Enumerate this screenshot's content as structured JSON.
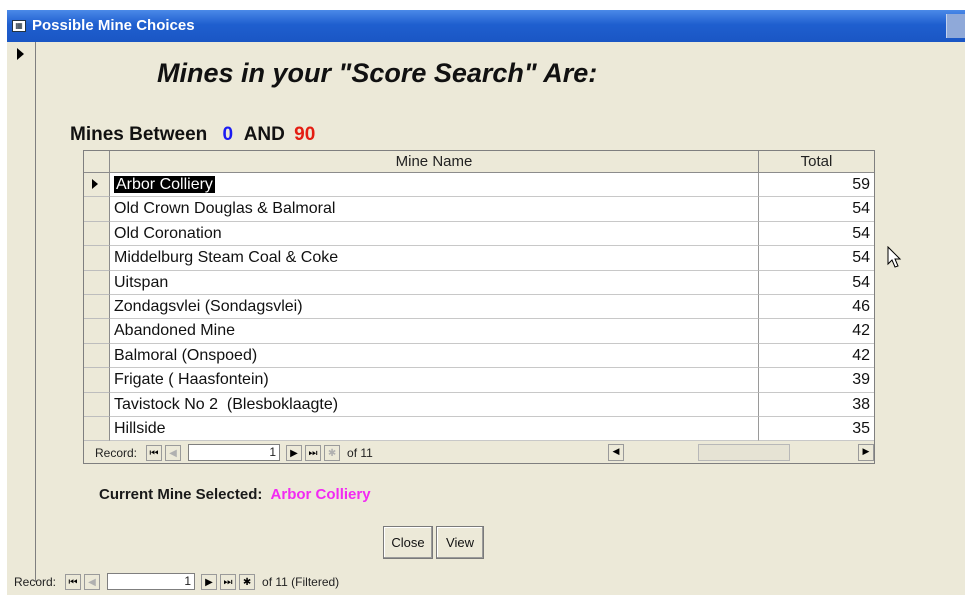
{
  "window": {
    "title": "Possible Mine Choices"
  },
  "heading": "Mines in your \"Score Search\" Are:",
  "between": {
    "label": "Mines Between",
    "low": "0",
    "and": "AND",
    "high": "90"
  },
  "columns": {
    "name": "Mine Name",
    "total": "Total"
  },
  "rows": [
    {
      "name": "Arbor Colliery",
      "total": "59"
    },
    {
      "name": "Old Crown Douglas & Balmoral",
      "total": "54"
    },
    {
      "name": "Old Coronation",
      "total": "54"
    },
    {
      "name": "Middelburg Steam Coal & Coke",
      "total": "54"
    },
    {
      "name": "Uitspan",
      "total": "54"
    },
    {
      "name": "Zondagsvlei (Sondagsvlei)",
      "total": "46"
    },
    {
      "name": "Abandoned Mine",
      "total": "42"
    },
    {
      "name": "Balmoral (Onspoed)",
      "total": "42"
    },
    {
      "name": "Frigate ( Haasfontein)",
      "total": "39"
    },
    {
      "name": "Tavistock No 2  (Blesboklaagte)",
      "total": "38"
    },
    {
      "name": "Hillside",
      "total": "35"
    }
  ],
  "subform_nav": {
    "label": "Record:",
    "current": "1",
    "of": "of 11"
  },
  "current_mine": {
    "label": "Current Mine Selected:",
    "value": "Arbor Colliery"
  },
  "buttons": {
    "close": "Close",
    "view": "View"
  },
  "form_nav": {
    "label": "Record:",
    "current": "1",
    "of": "of 11 (Filtered)"
  },
  "icons": [
    "form-icon",
    "record-selector-arrow-icon",
    "first-record-icon",
    "previous-record-icon",
    "next-record-icon",
    "last-record-icon",
    "new-record-icon",
    "scroll-left-icon",
    "scroll-right-icon",
    "mouse-pointer-icon"
  ],
  "colors": {
    "low": "#1b1bf2",
    "high": "#e41d12",
    "selected_mine": "#f22af2",
    "titlebar": "#1f5fcf"
  }
}
